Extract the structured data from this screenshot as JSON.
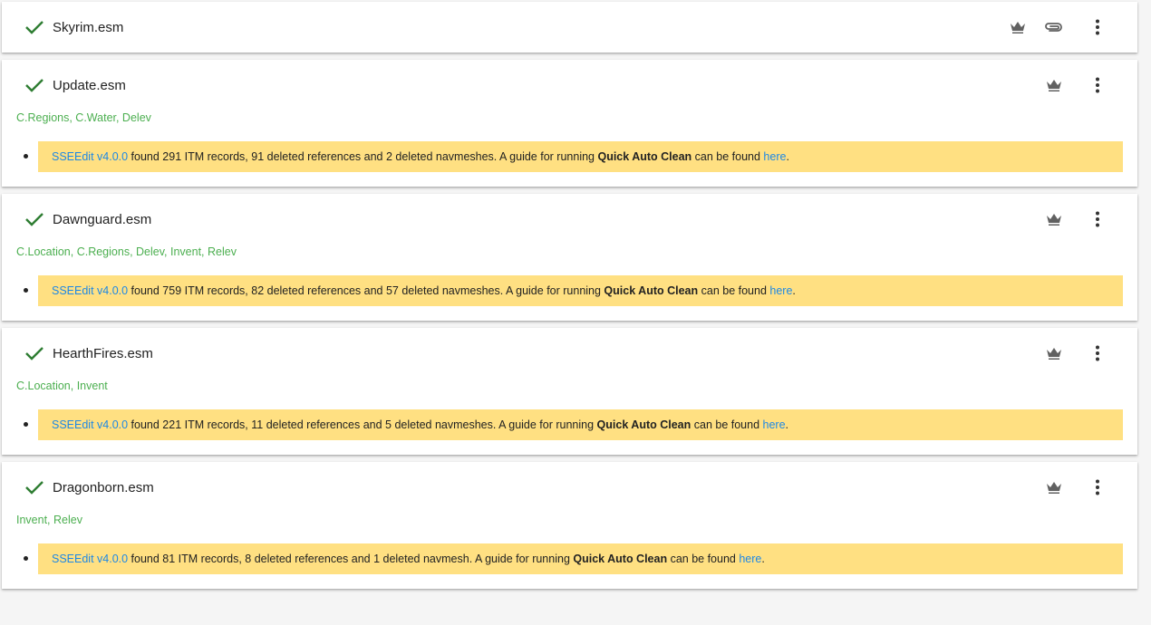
{
  "colors": {
    "check": "#2e7d32",
    "tags": "#4caf50",
    "message_bg": "#ffe082",
    "link": "#1e88e5",
    "icon": "#616161"
  },
  "plugins": [
    {
      "name": "Skyrim.esm",
      "icons": [
        "check-icon",
        "crown-icon",
        "paperclip-icon",
        "more-vert-icon"
      ]
    },
    {
      "name": "Update.esm",
      "tags": "C.Regions, C.Water, Delev",
      "message": {
        "tool": "SSEEdit v4.0.0",
        "text1": " found 291 ITM records, 91 deleted references and 2 deleted navmeshes. A guide for running ",
        "bold": "Quick Auto Clean",
        "text2": " can be found ",
        "link": "here",
        "end": "."
      }
    },
    {
      "name": "Dawnguard.esm",
      "tags": "C.Location, C.Regions, Delev, Invent, Relev",
      "message": {
        "tool": "SSEEdit v4.0.0",
        "text1": " found 759 ITM records, 82 deleted references and 57 deleted navmeshes. A guide for running ",
        "bold": "Quick Auto Clean",
        "text2": " can be found ",
        "link": "here",
        "end": "."
      }
    },
    {
      "name": "HearthFires.esm",
      "tags": "C.Location, Invent",
      "message": {
        "tool": "SSEEdit v4.0.0",
        "text1": " found 221 ITM records, 11 deleted references and 5 deleted navmeshes. A guide for running ",
        "bold": "Quick Auto Clean",
        "text2": " can be found ",
        "link": "here",
        "end": "."
      }
    },
    {
      "name": "Dragonborn.esm",
      "tags": "Invent, Relev",
      "message": {
        "tool": "SSEEdit v4.0.0",
        "text1": " found 81 ITM records, 8 deleted references and 1 deleted navmesh. A guide for running ",
        "bold": "Quick Auto Clean",
        "text2": " can be found ",
        "link": "here",
        "end": "."
      }
    }
  ]
}
